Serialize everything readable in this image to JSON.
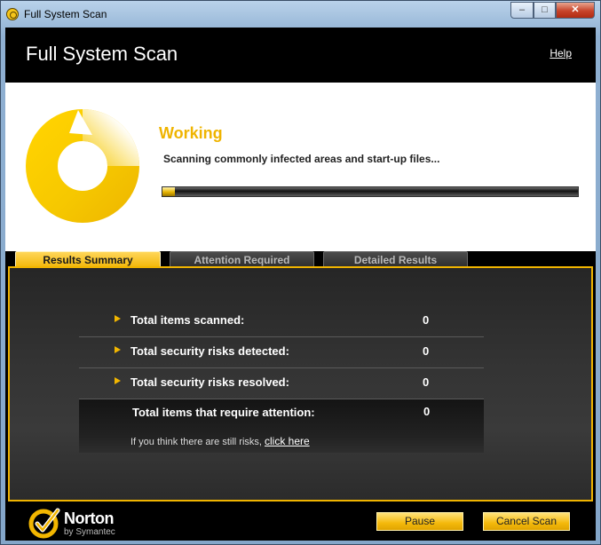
{
  "window": {
    "title": "Full System Scan",
    "minimize": "–",
    "maximize": "□",
    "close": "✕"
  },
  "header": {
    "title": "Full System Scan",
    "help": "Help"
  },
  "status": {
    "title": "Working",
    "description": "Scanning commonly infected areas and start-up files...",
    "progress_percent": 3
  },
  "tabs": [
    {
      "label": "Results Summary",
      "active": true
    },
    {
      "label": "Attention Required",
      "active": false
    },
    {
      "label": "Detailed Results",
      "active": false
    }
  ],
  "results": {
    "rows": [
      {
        "label": "Total items scanned:",
        "value": "0"
      },
      {
        "label": "Total security risks detected:",
        "value": "0"
      },
      {
        "label": "Total security risks resolved:",
        "value": "0"
      }
    ],
    "attention": {
      "label": "Total items that require attention:",
      "value": "0"
    },
    "risk_note": "If you think there are still risks,",
    "risk_link": "click here"
  },
  "footer": {
    "brand": "Norton",
    "brand_sub": "by Symantec",
    "pause_label": "Pause",
    "cancel_label": "Cancel Scan"
  },
  "colors": {
    "accent": "#f2b600",
    "status_title": "#efb400"
  }
}
